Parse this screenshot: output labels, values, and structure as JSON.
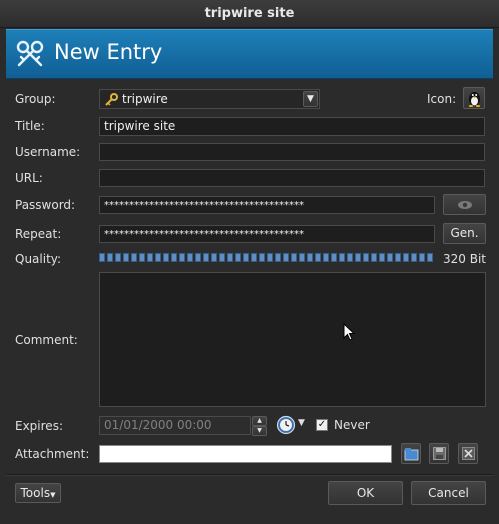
{
  "window": {
    "title": "tripwire site"
  },
  "banner": {
    "title": "New Entry",
    "icon": "keys-icon"
  },
  "form": {
    "group_label": "Group:",
    "group_value": "tripwire",
    "icon_label": "Icon:",
    "title_label": "Title:",
    "title_value": "tripwire site",
    "username_label": "Username:",
    "username_value": "",
    "url_label": "URL:",
    "url_value": "",
    "password_label": "Password:",
    "password_value": "****************************************",
    "repeat_label": "Repeat:",
    "repeat_value": "****************************************",
    "gen_label": "Gen.",
    "quality_label": "Quality:",
    "quality_value": "320 Bit",
    "quality_fraction": 1.0,
    "comment_label": "Comment:",
    "comment_value": "",
    "expires_label": "Expires:",
    "expires_value": "01/01/2000 00:00",
    "never_label": "Never",
    "never_checked": true,
    "attachment_label": "Attachment:",
    "attachment_value": ""
  },
  "buttons": {
    "tools": "Tools",
    "ok": "OK",
    "cancel": "Cancel"
  },
  "colors": {
    "banner": "#1271ad",
    "quality": "#5e8ec6"
  }
}
